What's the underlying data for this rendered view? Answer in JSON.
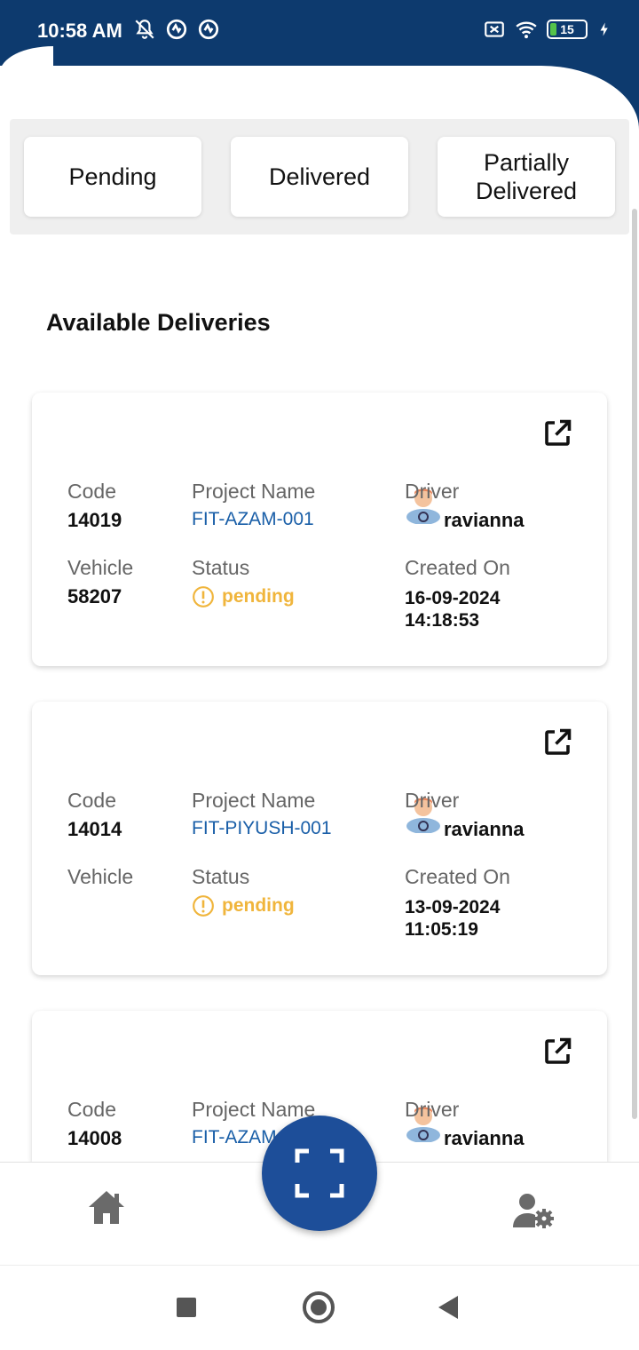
{
  "status_bar": {
    "time": "10:58 AM",
    "battery": "15",
    "icons_left": [
      "bell-off-icon",
      "sync-icon",
      "sync-icon"
    ],
    "icons_right": [
      "sim-off-icon",
      "wifi-icon",
      "battery-icon",
      "charging-icon"
    ]
  },
  "tabs": [
    {
      "label": "Pending"
    },
    {
      "label": "Delivered"
    },
    {
      "label": "Partially Delivered"
    }
  ],
  "section_title": "Available Deliveries",
  "labels": {
    "code": "Code",
    "project_name": "Project Name",
    "driver": "Driver",
    "vehicle": "Vehicle",
    "status": "Status",
    "created_on": "Created On"
  },
  "deliveries": [
    {
      "code": "14019",
      "project": "FIT-AZAM-001",
      "driver": "ravianna",
      "vehicle": "58207",
      "status": "pending",
      "created_date": "16-09-2024",
      "created_time": "14:18:53"
    },
    {
      "code": "14014",
      "project": "FIT-PIYUSH-001",
      "driver": "ravianna",
      "vehicle": "",
      "status": "pending",
      "created_date": "13-09-2024",
      "created_time": "11:05:19"
    },
    {
      "code": "14008",
      "project": "FIT-AZAM",
      "driver": "ravianna"
    }
  ],
  "colors": {
    "header": "#0d3a6e",
    "accent": "#1d4e99",
    "link": "#1a5fa8",
    "pending": "#f0b53c"
  }
}
